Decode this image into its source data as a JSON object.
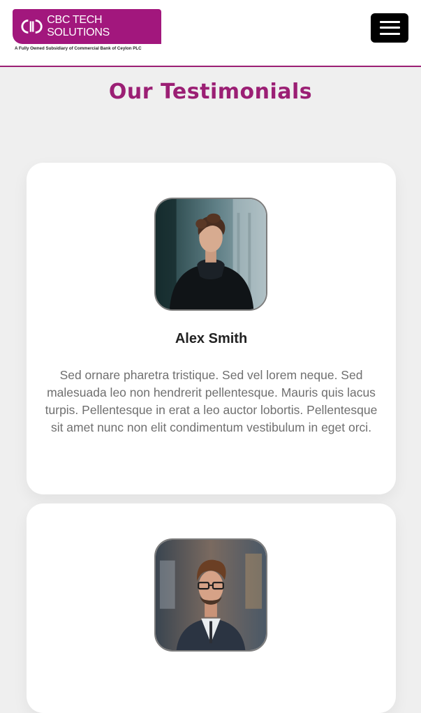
{
  "header": {
    "brand_name": "CBC TECH SOLUTIONS",
    "brand_tagline": "A Fully Owned Subsidiary of Commercial Bank of Ceylon PLC",
    "brand_color": "#a2177d",
    "menu_icon": "hamburger-menu-icon"
  },
  "section": {
    "title": "Our Testimonials",
    "title_color": "#9b1f74"
  },
  "testimonials": [
    {
      "name": "Alex Smith",
      "photo": "man-in-black-hoodie-photo",
      "quote": "Sed ornare pharetra tristique. Sed vel lorem neque. Sed malesuada leo non hendrerit pellentesque. Mauris quis lacus turpis. Pellentesque in erat a leo auctor lobortis. Pellentesque sit amet nunc non elit condimentum vestibulum in eget orci."
    },
    {
      "name": "",
      "photo": "man-with-glasses-and-vest-photo",
      "quote": ""
    }
  ]
}
